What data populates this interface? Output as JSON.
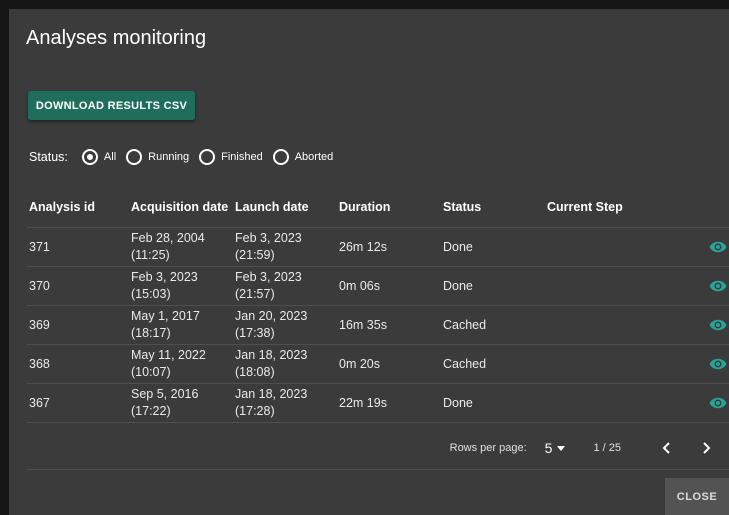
{
  "dialog": {
    "title": "Analyses monitoring",
    "download_label": "DOWNLOAD RESULTS CSV",
    "close_label": "CLOSE"
  },
  "filter": {
    "label": "Status:",
    "options": [
      {
        "label": "All",
        "checked": true
      },
      {
        "label": "Running",
        "checked": false
      },
      {
        "label": "Finished",
        "checked": false
      },
      {
        "label": "Aborted",
        "checked": false
      }
    ]
  },
  "table": {
    "headers": [
      "Analysis id",
      "Acquisition date",
      "Launch date",
      "Duration",
      "Status",
      "Current Step"
    ],
    "rows": [
      {
        "id": "371",
        "acq_date": "Feb 28, 2004",
        "acq_time": "(11:25)",
        "launch_date": "Feb 3, 2023",
        "launch_time": "(21:59)",
        "duration": "26m 12s",
        "status": "Done",
        "step": ""
      },
      {
        "id": "370",
        "acq_date": "Feb 3, 2023",
        "acq_time": "(15:03)",
        "launch_date": "Feb 3, 2023",
        "launch_time": "(21:57)",
        "duration": "0m 06s",
        "status": "Done",
        "step": ""
      },
      {
        "id": "369",
        "acq_date": "May 1, 2017",
        "acq_time": "(18:17)",
        "launch_date": "Jan 20, 2023",
        "launch_time": "(17:38)",
        "duration": "16m 35s",
        "status": "Cached",
        "step": ""
      },
      {
        "id": "368",
        "acq_date": "May 11, 2022",
        "acq_time": "(10:07)",
        "launch_date": "Jan 18, 2023",
        "launch_time": "(18:08)",
        "duration": "0m 20s",
        "status": "Cached",
        "step": ""
      },
      {
        "id": "367",
        "acq_date": "Sep 5, 2016",
        "acq_time": "(17:22)",
        "launch_date": "Jan 18, 2023",
        "launch_time": "(17:28)",
        "duration": "22m 19s",
        "status": "Done",
        "step": ""
      }
    ],
    "action_icon": "eye-icon"
  },
  "pagination": {
    "rows_per_page_label": "Rows per page:",
    "rows_per_page_value": "5",
    "page_indicator": "1 / 25"
  },
  "colors": {
    "dialog_bg": "#3b3b3b",
    "accent": "#1f6e5c",
    "icon_teal": "#26a69a"
  }
}
